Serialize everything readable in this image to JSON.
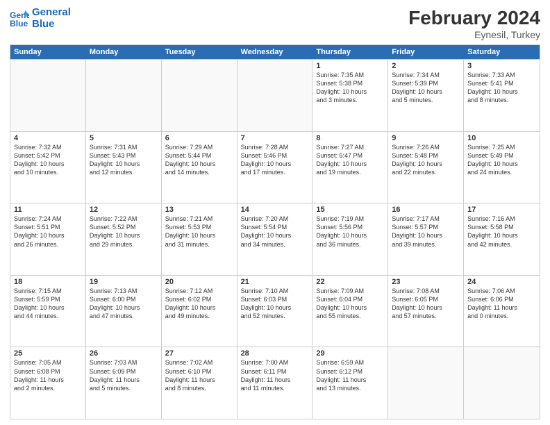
{
  "logo": {
    "line1": "General",
    "line2": "Blue"
  },
  "title": "February 2024",
  "location": "Eynesil, Turkey",
  "days_of_week": [
    "Sunday",
    "Monday",
    "Tuesday",
    "Wednesday",
    "Thursday",
    "Friday",
    "Saturday"
  ],
  "weeks": [
    [
      {
        "day": "",
        "info": ""
      },
      {
        "day": "",
        "info": ""
      },
      {
        "day": "",
        "info": ""
      },
      {
        "day": "",
        "info": ""
      },
      {
        "day": "1",
        "info": "Sunrise: 7:35 AM\nSunset: 5:38 PM\nDaylight: 10 hours\nand 3 minutes."
      },
      {
        "day": "2",
        "info": "Sunrise: 7:34 AM\nSunset: 5:39 PM\nDaylight: 10 hours\nand 5 minutes."
      },
      {
        "day": "3",
        "info": "Sunrise: 7:33 AM\nSunset: 5:41 PM\nDaylight: 10 hours\nand 8 minutes."
      }
    ],
    [
      {
        "day": "4",
        "info": "Sunrise: 7:32 AM\nSunset: 5:42 PM\nDaylight: 10 hours\nand 10 minutes."
      },
      {
        "day": "5",
        "info": "Sunrise: 7:31 AM\nSunset: 5:43 PM\nDaylight: 10 hours\nand 12 minutes."
      },
      {
        "day": "6",
        "info": "Sunrise: 7:29 AM\nSunset: 5:44 PM\nDaylight: 10 hours\nand 14 minutes."
      },
      {
        "day": "7",
        "info": "Sunrise: 7:28 AM\nSunset: 5:46 PM\nDaylight: 10 hours\nand 17 minutes."
      },
      {
        "day": "8",
        "info": "Sunrise: 7:27 AM\nSunset: 5:47 PM\nDaylight: 10 hours\nand 19 minutes."
      },
      {
        "day": "9",
        "info": "Sunrise: 7:26 AM\nSunset: 5:48 PM\nDaylight: 10 hours\nand 22 minutes."
      },
      {
        "day": "10",
        "info": "Sunrise: 7:25 AM\nSunset: 5:49 PM\nDaylight: 10 hours\nand 24 minutes."
      }
    ],
    [
      {
        "day": "11",
        "info": "Sunrise: 7:24 AM\nSunset: 5:51 PM\nDaylight: 10 hours\nand 26 minutes."
      },
      {
        "day": "12",
        "info": "Sunrise: 7:22 AM\nSunset: 5:52 PM\nDaylight: 10 hours\nand 29 minutes."
      },
      {
        "day": "13",
        "info": "Sunrise: 7:21 AM\nSunset: 5:53 PM\nDaylight: 10 hours\nand 31 minutes."
      },
      {
        "day": "14",
        "info": "Sunrise: 7:20 AM\nSunset: 5:54 PM\nDaylight: 10 hours\nand 34 minutes."
      },
      {
        "day": "15",
        "info": "Sunrise: 7:19 AM\nSunset: 5:56 PM\nDaylight: 10 hours\nand 36 minutes."
      },
      {
        "day": "16",
        "info": "Sunrise: 7:17 AM\nSunset: 5:57 PM\nDaylight: 10 hours\nand 39 minutes."
      },
      {
        "day": "17",
        "info": "Sunrise: 7:16 AM\nSunset: 5:58 PM\nDaylight: 10 hours\nand 42 minutes."
      }
    ],
    [
      {
        "day": "18",
        "info": "Sunrise: 7:15 AM\nSunset: 5:59 PM\nDaylight: 10 hours\nand 44 minutes."
      },
      {
        "day": "19",
        "info": "Sunrise: 7:13 AM\nSunset: 6:00 PM\nDaylight: 10 hours\nand 47 minutes."
      },
      {
        "day": "20",
        "info": "Sunrise: 7:12 AM\nSunset: 6:02 PM\nDaylight: 10 hours\nand 49 minutes."
      },
      {
        "day": "21",
        "info": "Sunrise: 7:10 AM\nSunset: 6:03 PM\nDaylight: 10 hours\nand 52 minutes."
      },
      {
        "day": "22",
        "info": "Sunrise: 7:09 AM\nSunset: 6:04 PM\nDaylight: 10 hours\nand 55 minutes."
      },
      {
        "day": "23",
        "info": "Sunrise: 7:08 AM\nSunset: 6:05 PM\nDaylight: 10 hours\nand 57 minutes."
      },
      {
        "day": "24",
        "info": "Sunrise: 7:06 AM\nSunset: 6:06 PM\nDaylight: 11 hours\nand 0 minutes."
      }
    ],
    [
      {
        "day": "25",
        "info": "Sunrise: 7:05 AM\nSunset: 6:08 PM\nDaylight: 11 hours\nand 2 minutes."
      },
      {
        "day": "26",
        "info": "Sunrise: 7:03 AM\nSunset: 6:09 PM\nDaylight: 11 hours\nand 5 minutes."
      },
      {
        "day": "27",
        "info": "Sunrise: 7:02 AM\nSunset: 6:10 PM\nDaylight: 11 hours\nand 8 minutes."
      },
      {
        "day": "28",
        "info": "Sunrise: 7:00 AM\nSunset: 6:11 PM\nDaylight: 11 hours\nand 11 minutes."
      },
      {
        "day": "29",
        "info": "Sunrise: 6:59 AM\nSunset: 6:12 PM\nDaylight: 11 hours\nand 13 minutes."
      },
      {
        "day": "",
        "info": ""
      },
      {
        "day": "",
        "info": ""
      }
    ]
  ]
}
